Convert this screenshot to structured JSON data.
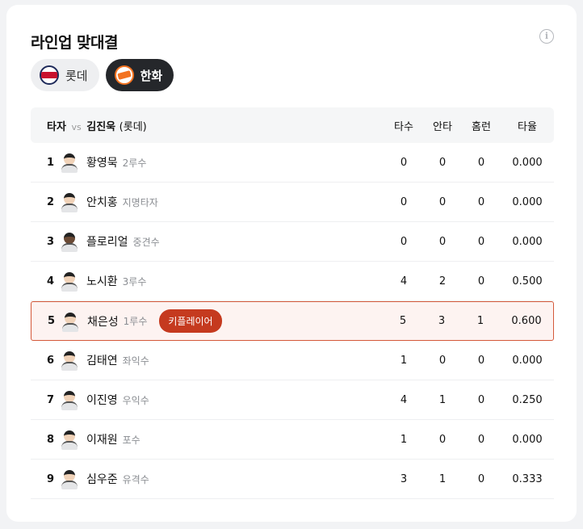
{
  "title": "라인업 맞대결",
  "info_icon": "i",
  "tabs": [
    {
      "label": "롯데",
      "icon": "lotte-logo-icon",
      "active": false
    },
    {
      "label": "한화",
      "icon": "hanwha-logo-icon",
      "active": true
    }
  ],
  "header": {
    "batter": "타자",
    "vs": "vs",
    "pitcher": "김진욱",
    "pitcher_team": "(롯데)",
    "columns": [
      "타수",
      "안타",
      "홈런",
      "타율"
    ]
  },
  "rows": [
    {
      "order": "1",
      "name": "황영묵",
      "position": "2루수",
      "ab": "0",
      "hits": "0",
      "hr": "0",
      "avg": "0.000"
    },
    {
      "order": "2",
      "name": "안치홍",
      "position": "지명타자",
      "ab": "0",
      "hits": "0",
      "hr": "0",
      "avg": "0.000"
    },
    {
      "order": "3",
      "name": "플로리얼",
      "position": "중견수",
      "ab": "0",
      "hits": "0",
      "hr": "0",
      "avg": "0.000"
    },
    {
      "order": "4",
      "name": "노시환",
      "position": "3루수",
      "ab": "4",
      "hits": "2",
      "hr": "0",
      "avg": "0.500"
    },
    {
      "order": "5",
      "name": "채은성",
      "position": "1루수",
      "badge": "키플레이어",
      "ab": "5",
      "hits": "3",
      "hr": "1",
      "avg": "0.600"
    },
    {
      "order": "6",
      "name": "김태연",
      "position": "좌익수",
      "ab": "1",
      "hits": "0",
      "hr": "0",
      "avg": "0.000"
    },
    {
      "order": "7",
      "name": "이진영",
      "position": "우익수",
      "ab": "4",
      "hits": "1",
      "hr": "0",
      "avg": "0.250"
    },
    {
      "order": "8",
      "name": "이재원",
      "position": "포수",
      "ab": "1",
      "hits": "0",
      "hr": "0",
      "avg": "0.000"
    },
    {
      "order": "9",
      "name": "심우준",
      "position": "유격수",
      "ab": "3",
      "hits": "1",
      "hr": "0",
      "avg": "0.333"
    }
  ],
  "colors": {
    "accent": "#c53a1f",
    "active_tab": "#25272b",
    "highlight_bg": "#fdf3f1"
  }
}
